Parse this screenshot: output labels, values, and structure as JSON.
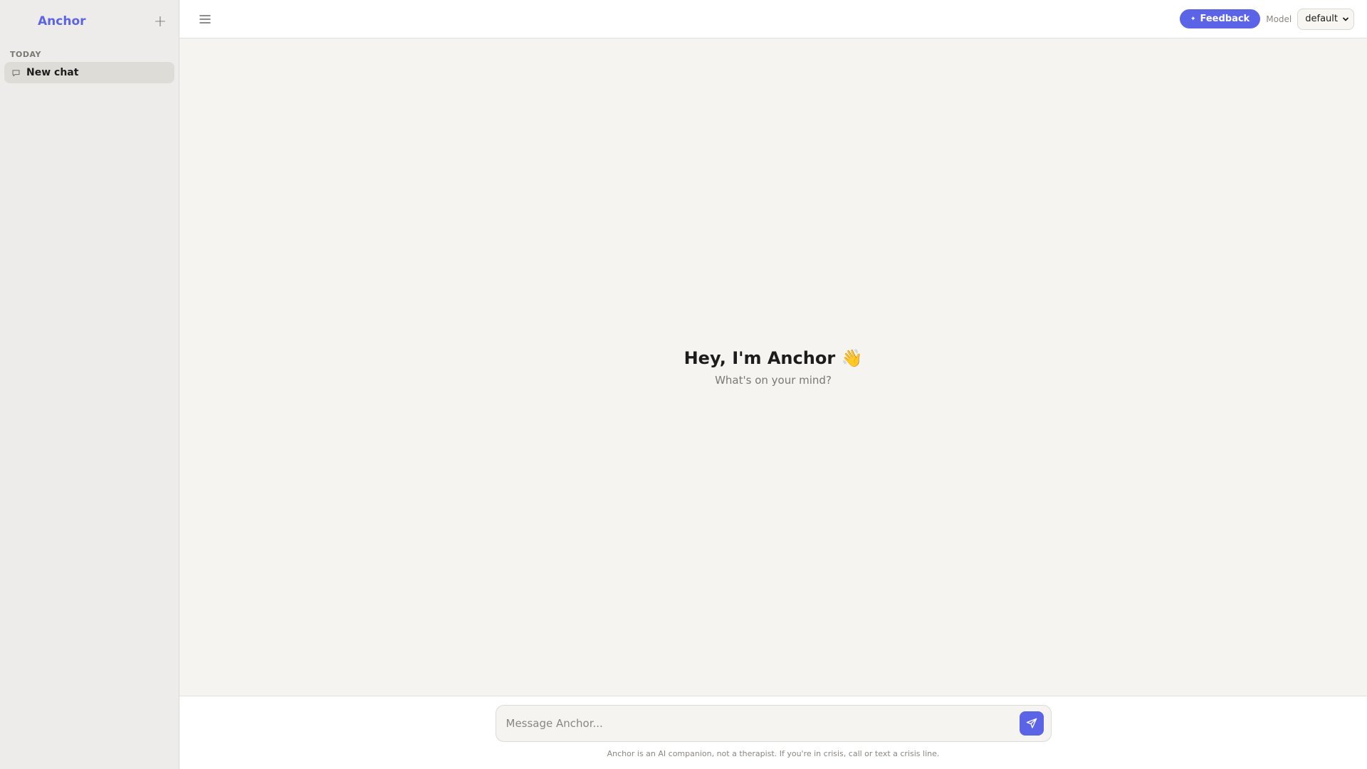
{
  "sidebar": {
    "brand": "Anchor",
    "new_chat_icon": "plus-icon",
    "new_chat_symbol": "+",
    "section_label": "TODAY",
    "items": [
      {
        "label": "New chat",
        "icon": "chat-bubble-icon"
      }
    ]
  },
  "topbar": {
    "menu_icon": "hamburger-icon",
    "feedback_label": "Feedback",
    "feedback_icon": "sparkle-icon",
    "feedback_symbol": "✦",
    "model_label": "Model",
    "model_value": "default"
  },
  "conversation": {
    "greeting": "Hey, I'm Anchor 👋",
    "subgreeting": "What's on your mind?"
  },
  "composer": {
    "placeholder": "Message Anchor...",
    "send_icon": "send-icon",
    "disclaimer": "Anchor is an AI companion, not a therapist. If you're in crisis, call or text a crisis line."
  },
  "colors": {
    "accent": "#5b63e6",
    "sidebar_bg": "#edecea",
    "main_bg": "#f5f4f1",
    "active_item_bg": "#dedcd7"
  }
}
